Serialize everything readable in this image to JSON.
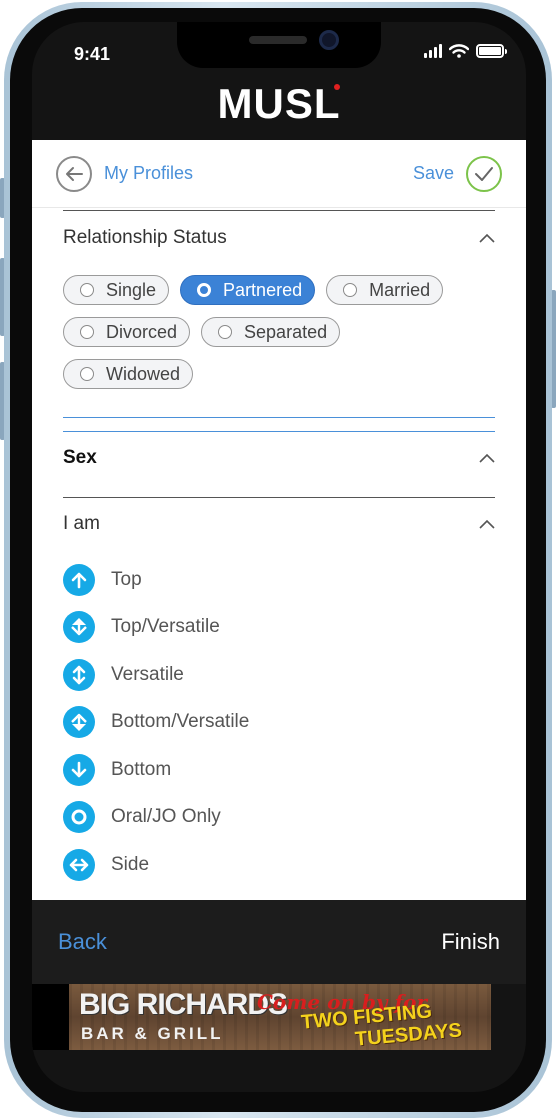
{
  "status_bar": {
    "time": "9:41"
  },
  "header": {
    "logo": "MUSL"
  },
  "topbar": {
    "back_label": "My Profiles",
    "save_label": "Save"
  },
  "relationship": {
    "title": "Relationship Status",
    "options": [
      {
        "label": "Single",
        "selected": false
      },
      {
        "label": "Partnered",
        "selected": true
      },
      {
        "label": "Married",
        "selected": false
      },
      {
        "label": "Divorced",
        "selected": false
      },
      {
        "label": "Separated",
        "selected": false
      },
      {
        "label": "Widowed",
        "selected": false
      }
    ]
  },
  "sex": {
    "title": "Sex"
  },
  "i_am": {
    "title": "I am",
    "options": [
      {
        "label": "Top",
        "icon": "arrow-up-icon"
      },
      {
        "label": "Top/Versatile",
        "icon": "arrows-up-down-diamond-icon"
      },
      {
        "label": "Versatile",
        "icon": "arrows-up-down-icon"
      },
      {
        "label": "Bottom/Versatile",
        "icon": "arrows-down-diamond-icon"
      },
      {
        "label": "Bottom",
        "icon": "arrow-down-icon"
      },
      {
        "label": "Oral/JO Only",
        "icon": "ring-icon"
      },
      {
        "label": "Side",
        "icon": "arrows-left-right-icon"
      }
    ]
  },
  "footer": {
    "back_label": "Back",
    "finish_label": "Finish"
  },
  "ad": {
    "title": "BIG RICHARDS",
    "subtitle": "BAR & GRILL",
    "script": "Come on by for",
    "promo_line1": "TWO FISTING",
    "promo_line2": "TUESDAYS"
  },
  "colors": {
    "accent": "#4a90d9",
    "selected": "#3b82d6",
    "icon": "#16a9e6",
    "save_check": "#7cc34a"
  }
}
